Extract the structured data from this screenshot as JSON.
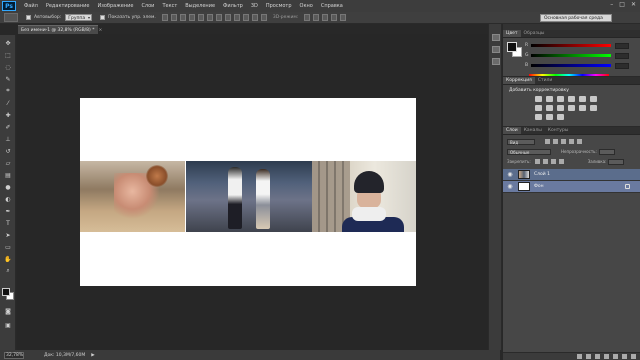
{
  "app": {
    "logo": "Ps",
    "menu": [
      "Файл",
      "Редактирование",
      "Изображение",
      "Слои",
      "Текст",
      "Выделение",
      "Фильтр",
      "3D",
      "Просмотр",
      "Окно",
      "Справка"
    ],
    "window_controls": [
      "–",
      "□",
      "✕"
    ]
  },
  "options_bar": {
    "auto_select_label": "Автовыбор:",
    "auto_select_value": "Группа",
    "show_controls_label": "Показать упр. элем.",
    "mode_3d_label": "3D-режим:",
    "workspace": "Основная рабочая среда"
  },
  "document": {
    "tab_title": "Без имени-1 @ 32,8% (RGB/8) *",
    "tab_close": "×"
  },
  "toolbar_icons": [
    "move-icon",
    "marquee-icon",
    "lasso-icon",
    "quick-select-icon",
    "crop-icon",
    "eyedropper-icon",
    "healing-icon",
    "brush-icon",
    "clone-stamp-icon",
    "history-brush-icon",
    "eraser-icon",
    "gradient-icon",
    "blur-icon",
    "dodge-icon",
    "pen-icon",
    "type-icon",
    "path-select-icon",
    "shape-icon",
    "hand-icon",
    "zoom-icon"
  ],
  "status": {
    "zoom": "32,78%",
    "doc": "Док: 10,3M/7,60M",
    "arrow": "▶"
  },
  "panels": {
    "color_tabs": [
      "Цвет",
      "Образцы"
    ],
    "color_channels": [
      "R",
      "G",
      "B"
    ],
    "adjust_tabs": [
      "Коррекция",
      "Стили"
    ],
    "adjust_title": "Добавить корректировку",
    "layers_tabs": [
      "Слои",
      "Каналы",
      "Контуры"
    ],
    "kind_select": "Вид",
    "blend_mode": "Обычные",
    "opacity_label": "Непрозрачность:",
    "lock_label": "Закрепить:",
    "fill_label": "Заливка:",
    "layers": [
      {
        "name": "Слой 1",
        "selected": true
      },
      {
        "name": "Фон",
        "selected": false,
        "locked": true
      }
    ]
  },
  "colors": {
    "menubar": "#3d3d3d",
    "canvas_bg": "#272727",
    "panel_bg": "#474747",
    "selection": "#5b6d8c",
    "accent": "#31a8ff"
  }
}
